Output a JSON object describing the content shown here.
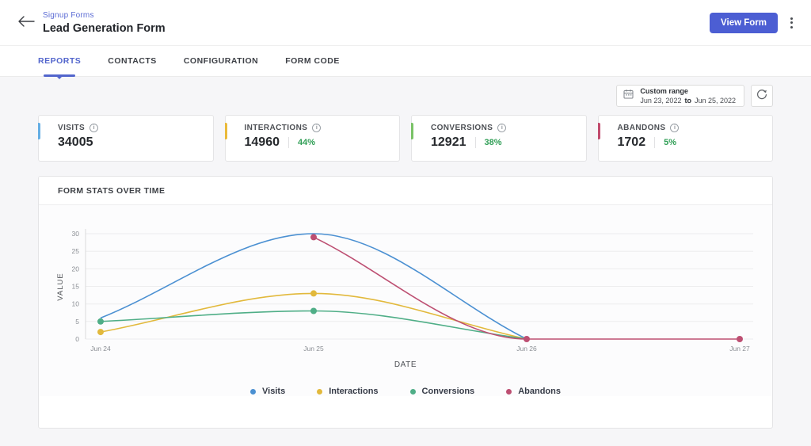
{
  "header": {
    "breadcrumb": "Signup Forms",
    "title": "Lead Generation Form",
    "view_form_button": "View Form"
  },
  "tabs": [
    {
      "label": "REPORTS",
      "active": true
    },
    {
      "label": "CONTACTS",
      "active": false
    },
    {
      "label": "CONFIGURATION",
      "active": false
    },
    {
      "label": "FORM CODE",
      "active": false
    }
  ],
  "toolbar": {
    "range_label": "Custom range",
    "range_start": "Jun 23, 2022",
    "range_separator": "to",
    "range_end": "Jun 25, 2022"
  },
  "stats": [
    {
      "label": "VISITS",
      "value": "34005",
      "percent": null,
      "accent": "#64aee4"
    },
    {
      "label": "INTERACTIONS",
      "value": "14960",
      "percent": "44%",
      "accent": "#eaba3a"
    },
    {
      "label": "CONVERSIONS",
      "value": "12921",
      "percent": "38%",
      "accent": "#79c267"
    },
    {
      "label": "ABANDONS",
      "value": "1702",
      "percent": "5%",
      "accent": "#c14b6d"
    }
  ],
  "icons": {
    "back": "left-arrow",
    "menu": "kebab-vertical-dots",
    "calendar": "calendar",
    "refresh": "circular-arrow",
    "info": "info-circle"
  },
  "colors": {
    "brand_button": "#4c5ed3",
    "tab_active": "#5265cc",
    "percent_green": "#2f9e55",
    "page_background": "#f6f6f8"
  },
  "chart_data": {
    "type": "line",
    "title": "FORM STATS OVER TIME",
    "xlabel": "DATE",
    "ylabel": "VALUE",
    "categories": [
      "Jun 24",
      "Jun 25",
      "Jun 26",
      "Jun 27"
    ],
    "ylim": [
      0,
      30
    ],
    "yticks": [
      0,
      5,
      10,
      15,
      20,
      25,
      30
    ],
    "grid": true,
    "legend_position": "bottom",
    "series": [
      {
        "name": "Visits",
        "color": "#4b90d2",
        "values": [
          6,
          30,
          0,
          null
        ],
        "markers": [
          false,
          false,
          false,
          false
        ]
      },
      {
        "name": "Interactions",
        "color": "#e2b93c",
        "values": [
          2,
          13,
          0,
          null
        ],
        "markers": [
          true,
          true,
          false,
          false
        ]
      },
      {
        "name": "Conversions",
        "color": "#4fae87",
        "values": [
          5,
          8,
          0,
          null
        ],
        "markers": [
          true,
          true,
          false,
          false
        ]
      },
      {
        "name": "Abandons",
        "color": "#bd4f72",
        "values": [
          null,
          29,
          0,
          0
        ],
        "markers": [
          false,
          true,
          true,
          true
        ]
      }
    ]
  }
}
